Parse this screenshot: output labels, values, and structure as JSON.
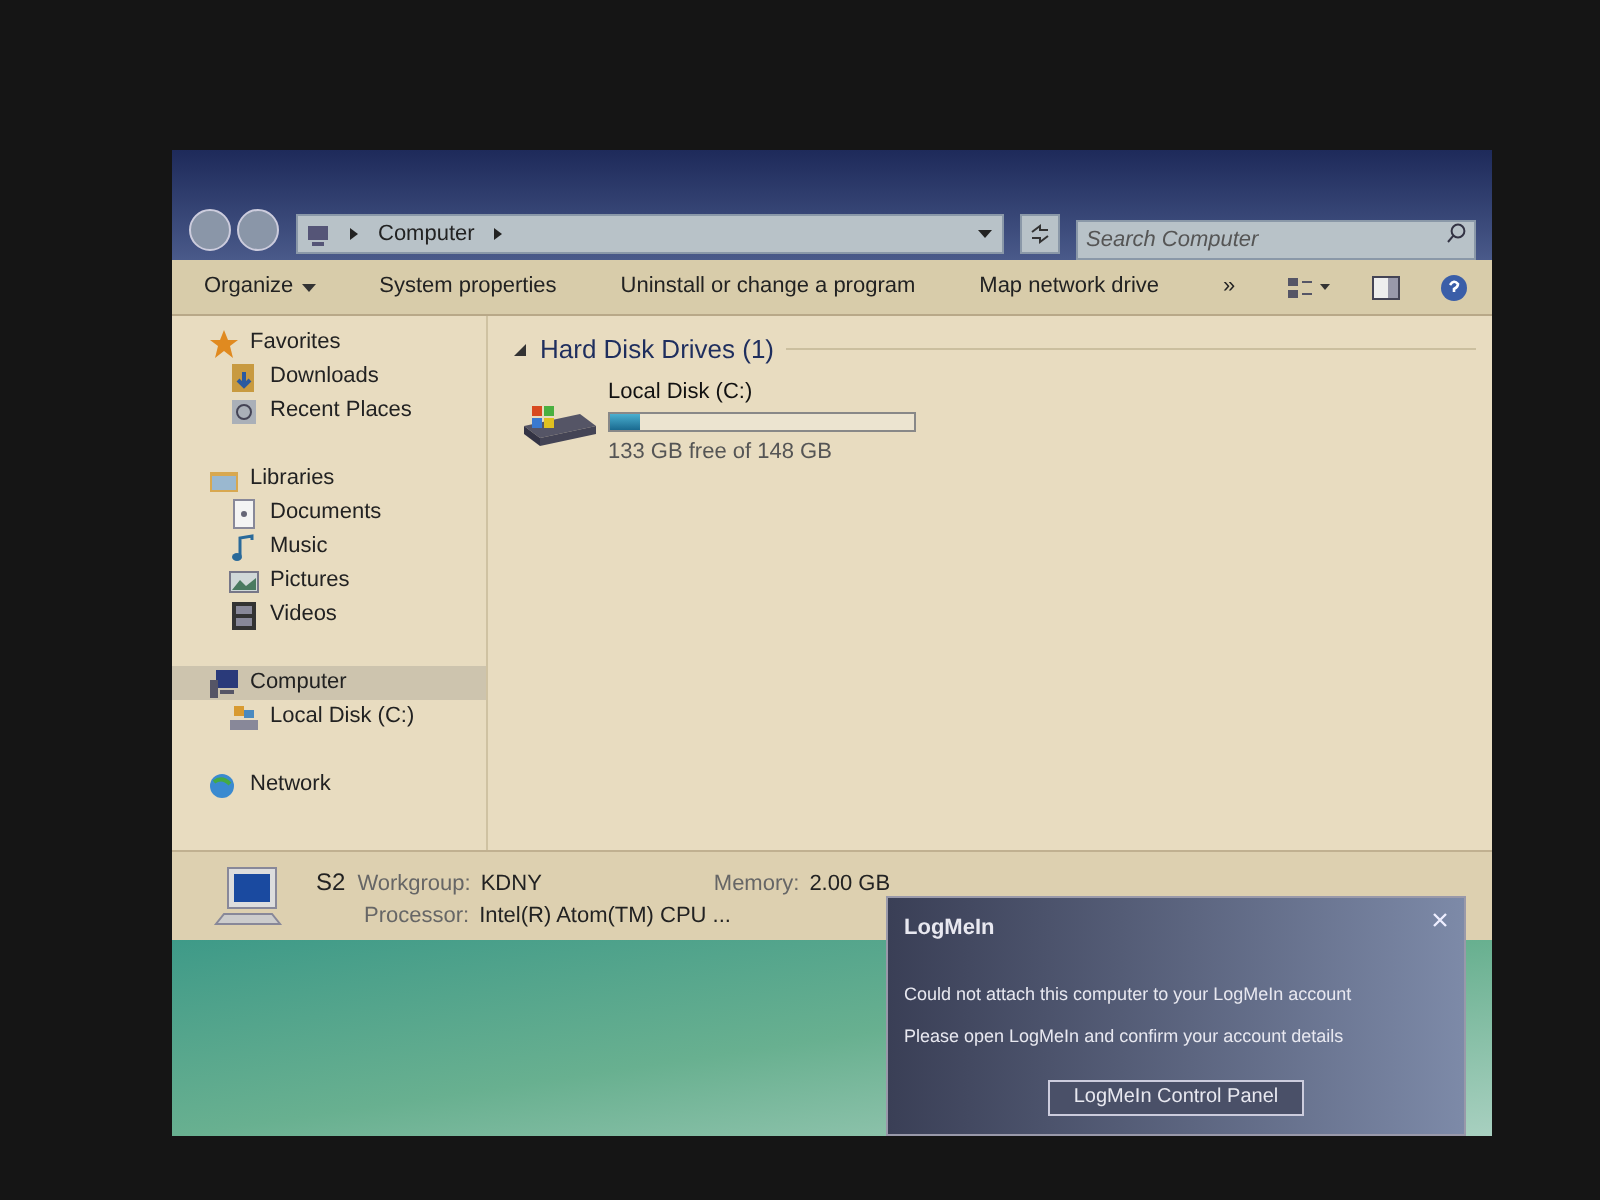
{
  "address_bar": {
    "path": [
      "Computer"
    ]
  },
  "search": {
    "placeholder": "Search Computer"
  },
  "toolbar": {
    "buttons": [
      {
        "label": "Organize",
        "kind": "dropdown"
      },
      {
        "label": "System properties",
        "kind": "plain"
      },
      {
        "label": "Uninstall or change a program",
        "kind": "plain"
      },
      {
        "label": "Map network drive",
        "kind": "plain"
      },
      {
        "label": "»",
        "kind": "plain"
      }
    ]
  },
  "nav_pane": {
    "groups": [
      {
        "label": "Favorites",
        "selected": false,
        "children": [
          {
            "label": "Downloads",
            "selected": false
          },
          {
            "label": "Recent Places",
            "selected": false
          }
        ]
      },
      {
        "label": "Libraries",
        "selected": false,
        "children": [
          {
            "label": "Documents",
            "selected": false
          },
          {
            "label": "Music",
            "selected": false
          },
          {
            "label": "Pictures",
            "selected": false
          },
          {
            "label": "Videos",
            "selected": false
          }
        ]
      },
      {
        "label": "Computer",
        "selected": true,
        "children": [
          {
            "label": "Local Disk (C:)",
            "selected": false
          }
        ]
      },
      {
        "label": "Network",
        "selected": false
      }
    ]
  },
  "content": {
    "section": {
      "title": "Hard Disk Drives (1)",
      "expanded": true,
      "drives": [
        {
          "name": "Local Disk (C:)",
          "level": 0.1,
          "free": "133 GB free of 148 GB"
        }
      ]
    }
  },
  "details_pane": {
    "name": "S2",
    "fields": [
      {
        "label": "Workgroup:",
        "value": "KDNY"
      },
      {
        "label": "Memory:",
        "value": "2.00 GB"
      },
      {
        "label": "Processor:",
        "value": "Intel(R) Atom(TM) CPU ..."
      }
    ]
  },
  "notification": {
    "title": "LogMeIn",
    "lines": [
      "Could not attach this computer to your LogMeIn account",
      "Please open LogMeIn and confirm your account details"
    ],
    "button": "LogMeIn Control Panel"
  }
}
